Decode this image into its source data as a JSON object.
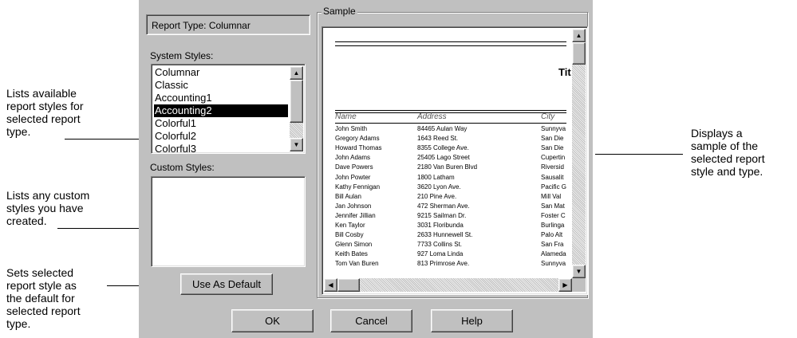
{
  "annotations": {
    "left1": [
      "Lists available",
      "report styles for",
      "selected report",
      "type."
    ],
    "left2": [
      "Lists any custom",
      "styles you have",
      "created."
    ],
    "left3": [
      "Sets selected",
      "report style as",
      "the default for",
      "selected report",
      "type."
    ],
    "right": [
      "Displays a",
      "sample of the",
      "selected report",
      "style and type."
    ]
  },
  "dialog": {
    "report_type": "Report Type: Columnar",
    "system_styles_label": "System Styles:",
    "system_styles": [
      "Columnar",
      "Classic",
      "Accounting1",
      "Accounting2",
      "Colorful1",
      "Colorful2",
      "Colorful3"
    ],
    "selected_style": "Accounting2",
    "custom_styles_label": "Custom Styles:",
    "use_as_default": "Use As Default",
    "sample_label": "Sample",
    "ok": "OK",
    "cancel": "Cancel",
    "help": "Help"
  },
  "sample": {
    "title_fragment": "Tit",
    "headers": [
      "Name",
      "Address",
      "City"
    ],
    "rows": [
      [
        "John Smith",
        "84465 Aulan Way",
        "Sunnyva"
      ],
      [
        "Gregory Adams",
        "1643 Reed St.",
        "San Die"
      ],
      [
        "Howard Thomas",
        "8355 College Ave.",
        "San Die"
      ],
      [
        "John Adams",
        "25405 Lago Street",
        "Cupertin"
      ],
      [
        "Dave Powers",
        "2180 Van Buren Blvd",
        "Riversid"
      ],
      [
        "John Powter",
        "1800 Latham",
        "Sausalit"
      ],
      [
        "Kathy Fennigan",
        "3620 Lyon Ave.",
        "Pacific G"
      ],
      [
        "Bill Aulan",
        "210 Pine Ave.",
        "Mill Val"
      ],
      [
        "Jan Johnson",
        "472 Sherman Ave.",
        "San Mat"
      ],
      [
        "Jennifer Jillian",
        "9215 Sailman Dr.",
        "Foster C"
      ],
      [
        "Ken Taylor",
        "3031 Floribunda",
        "Burlinga"
      ],
      [
        "Bill Cosby",
        "2633 Hunnewell St.",
        "Palo Alt"
      ],
      [
        "Glenn Simon",
        "7733 Collins St.",
        "San Fra"
      ],
      [
        "Keith Bates",
        "927 Loma Linda",
        "Alameda"
      ],
      [
        "Tom Van Buren",
        "813 Primrose Ave.",
        "Sunnyva"
      ]
    ]
  }
}
